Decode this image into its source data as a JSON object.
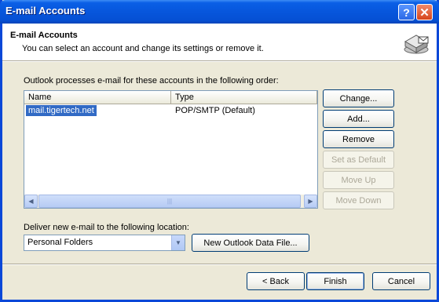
{
  "window": {
    "title": "E-mail Accounts",
    "help_glyph": "?",
    "close_glyph": "✕"
  },
  "header": {
    "title": "E-mail Accounts",
    "subtitle": "You can select an account and change its settings or remove it."
  },
  "accounts_section": {
    "label": "Outlook processes e-mail for these accounts in the following order:",
    "columns": [
      "Name",
      "Type"
    ],
    "rows": [
      {
        "name": "mail.tigertech.net",
        "type": "POP/SMTP (Default)",
        "selected": true
      }
    ],
    "scroll_left_glyph": "◀",
    "scroll_right_glyph": "▶",
    "scroll_grip_glyph": "|||"
  },
  "side_buttons": {
    "change": "Change...",
    "add": "Add...",
    "remove": "Remove",
    "set_default": "Set as Default",
    "move_up": "Move Up",
    "move_down": "Move Down"
  },
  "delivery": {
    "label": "Deliver new e-mail to the following location:",
    "selected_value": "Personal Folders",
    "dropdown_glyph": "▼",
    "new_file_button": "New Outlook Data File..."
  },
  "footer": {
    "back": "< Back",
    "finish": "Finish",
    "cancel": "Cancel"
  },
  "colors": {
    "titlebar": "#0756dc",
    "selection": "#316ac5",
    "dialog_bg": "#ece9d8"
  },
  "icons": {
    "header_icon": "email-accounts-icon"
  }
}
